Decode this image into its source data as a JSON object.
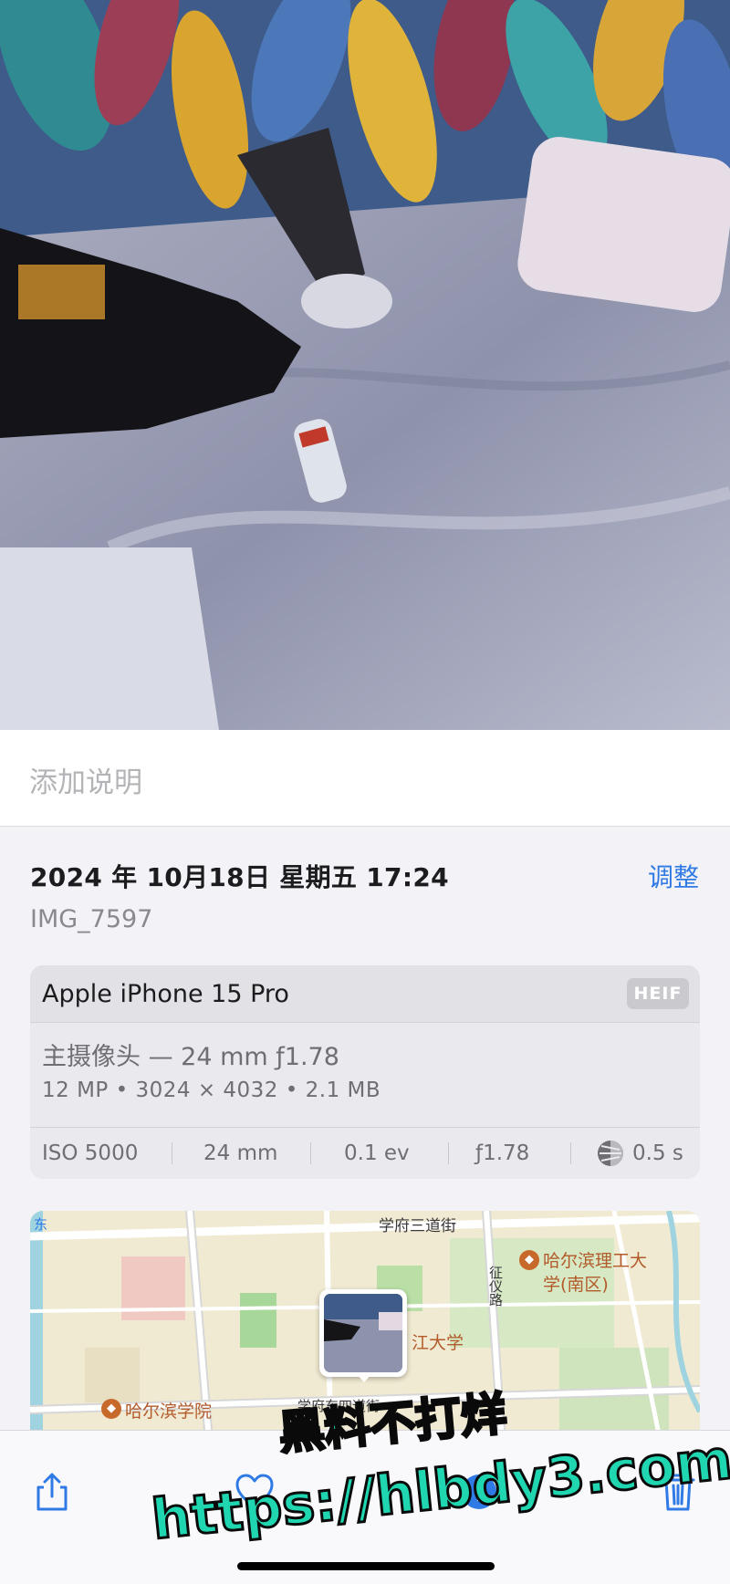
{
  "caption": {
    "placeholder": "添加说明"
  },
  "info": {
    "datetime": "2024 年 10月18日 星期五 17:24",
    "adjust_label": "调整",
    "filename": "IMG_7597"
  },
  "camera_card": {
    "device": "Apple iPhone 15 Pro",
    "format_badge": "HEIF",
    "lens": "主摄像头 — 24 mm ƒ1.78",
    "specs": "12 MP • 3024 × 4032 • 2.1 MB",
    "exif": {
      "iso": "ISO 5000",
      "focal": "24 mm",
      "ev": "0.1 ev",
      "aperture": "ƒ1.78",
      "shutter": "0.5 s"
    }
  },
  "map": {
    "labels": {
      "road_top": "学府三道街",
      "road_vertical": "征仪路",
      "poi_1": "哈尔滨理工大",
      "poi_1b": "学(南区)",
      "univ": "江大学",
      "road_bottom": "学府东四道街",
      "poi_2": "哈尔滨学院",
      "edge": "东"
    }
  },
  "toolbar": {
    "icons": [
      "share-icon",
      "heart-icon",
      "info-icon",
      "trash-icon"
    ]
  },
  "watermark": {
    "line1": "黑料不打烊",
    "line2": "https://hlbdy3.com"
  },
  "colors": {
    "accent": "#2f7ae5",
    "background": "#f2f2f7",
    "watermark": "#1fd6b0"
  }
}
